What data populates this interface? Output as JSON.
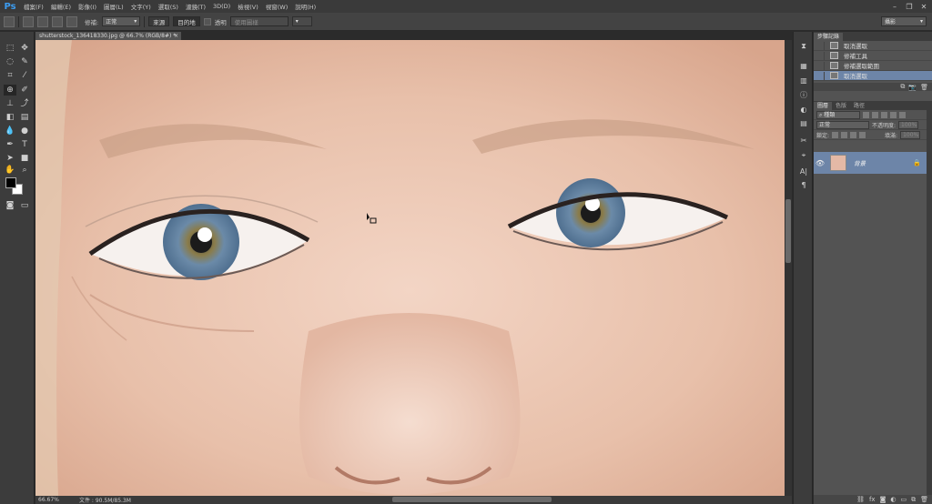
{
  "app": {
    "logo": "Ps"
  },
  "menubar": {
    "items": [
      "檔案(F)",
      "編輯(E)",
      "影像(I)",
      "圖層(L)",
      "文字(Y)",
      "選取(S)",
      "濾鏡(T)",
      "3D(D)",
      "檢視(V)",
      "視窗(W)",
      "說明(H)"
    ],
    "window_controls": [
      "–",
      "❐",
      "✕"
    ]
  },
  "optionsbar": {
    "patch_label": "修補:",
    "patch_mode": "正常",
    "source_button": "來源",
    "destination_button": "目的地",
    "transparent_label": "透明",
    "use_pattern_button": "使用圖樣",
    "workspace": "攝影"
  },
  "document": {
    "tab_title": "shutterstock_136418330.jpg @ 66.7% (RGB/8#) *",
    "close_glyph": "×"
  },
  "statusbar": {
    "zoom": "66.67%",
    "doc_info": "文件 : 90.5M/85.3M"
  },
  "history_panel": {
    "tab_label": "步驟記錄",
    "steps": [
      {
        "label": "取消選取",
        "selected": false
      },
      {
        "label": "修補工具",
        "selected": false
      },
      {
        "label": "修補選取範圍",
        "selected": false
      },
      {
        "label": "取消選取",
        "selected": true
      }
    ]
  },
  "layers_panel": {
    "tabs": [
      "圖層",
      "色版",
      "路徑"
    ],
    "filter_kind": "種類",
    "blend_mode": "正常",
    "opacity_label": "不透明度:",
    "opacity_value": "100%",
    "lock_label": "鎖定:",
    "fill_label": "填滿:",
    "fill_value": "100%",
    "layers": [
      {
        "name": "背景",
        "visible": true,
        "locked": true
      }
    ]
  },
  "colors": {
    "selection_blue": "#6d85a8",
    "panel_bg": "#535353",
    "skin": "#e8c2ad"
  }
}
